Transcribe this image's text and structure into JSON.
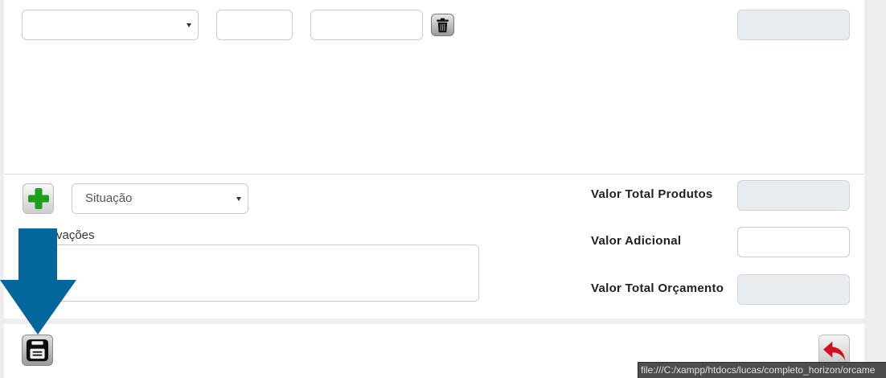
{
  "item_row": {
    "select_value": "",
    "input_a_value": "",
    "input_b_value": "",
    "total_value": ""
  },
  "footer_form": {
    "situacao": {
      "selected": "Situação"
    },
    "observations_label": "vações",
    "observations_value": "",
    "totals": [
      {
        "label": "Valor Total Produtos",
        "value": "",
        "disabled": true
      },
      {
        "label": "Valor Adicional",
        "value": "",
        "disabled": false
      },
      {
        "label": "Valor Total Orçamento",
        "value": "",
        "disabled": true
      }
    ]
  },
  "icons": {
    "delete_row": "trash-icon",
    "add_row": "plus-icon",
    "save": "save-icon",
    "back": "undo-arrow-icon",
    "dropdown": "chevron-down-icon",
    "annotation": "down-arrow-icon"
  },
  "colors": {
    "annotation_blue": "#04679c",
    "add_green": "#1e9e1e",
    "back_red": "#d10f1e",
    "disabled_bg": "#e9ecef"
  },
  "status_bar": {
    "url": "file:///C:/xampp/htdocs/lucas/completo_horizon/orcame"
  }
}
